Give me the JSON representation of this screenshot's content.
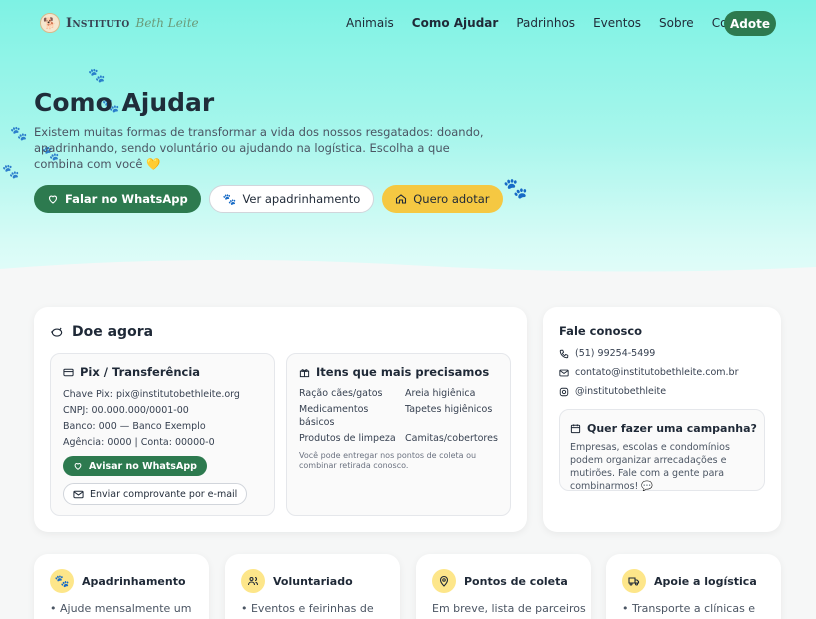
{
  "brand": {
    "name": "Instituto",
    "script": "Beth Leite"
  },
  "nav": {
    "items": [
      {
        "label": "Animais",
        "active": false
      },
      {
        "label": "Como Ajudar",
        "active": true
      },
      {
        "label": "Padrinhos",
        "active": false
      },
      {
        "label": "Eventos",
        "active": false
      },
      {
        "label": "Sobre",
        "active": false
      },
      {
        "label": "Contato",
        "active": false
      }
    ],
    "cta": "Adote"
  },
  "hero": {
    "title": "Como Ajudar",
    "description": "Existem muitas formas de transformar a vida dos nossos resgatados: doando, apadrinhando, sendo voluntário ou ajudando na logística. Escolha a que combina com você 💛",
    "buttons": {
      "whatsapp": "Falar no WhatsApp",
      "sponsor": "Ver apadrinhamento",
      "adopt": "Quero adotar"
    }
  },
  "donate": {
    "title": "Doe agora",
    "pix": {
      "title": "Pix / Transferência",
      "lines": [
        {
          "label": "Chave Pix:",
          "value": "pix@institutobethleite.org"
        },
        {
          "label": "CNPJ:",
          "value": "00.000.000/0001-00"
        },
        {
          "label": "Banco:",
          "value": "000 — Banco Exemplo"
        },
        {
          "label": "Agência:",
          "value": "0000 | Conta: 00000-0"
        }
      ],
      "whatsapp_btn": "Avisar no WhatsApp",
      "email_btn": "Enviar comprovante por e-mail"
    },
    "needs": {
      "title": "Itens que mais precisamos",
      "items": [
        "Ração cães/gatos",
        "Areia higiênica",
        "Medicamentos básicos",
        "Tapetes higiênicos",
        "Produtos de limpeza",
        "Camitas/cobertores"
      ],
      "note": "Você pode entregar nos pontos de coleta ou combinar retirada conosco."
    }
  },
  "contact": {
    "title": "Fale conosco",
    "phone": "(51) 99254-5499",
    "email": "contato@institutobethleite.com.br",
    "instagram": "@institutobethleite",
    "campaign": {
      "title": "Quer fazer uma campanha?",
      "text": "Empresas, escolas e condomínios podem organizar arrecadações e mutirões. Fale com a gente para combinarmos! 💬"
    }
  },
  "features": [
    {
      "title": "Apadrinhamento",
      "text": "• Ajude mensalmente um"
    },
    {
      "title": "Voluntariado",
      "text": "• Eventos e feirinhas de"
    },
    {
      "title": "Pontos de coleta",
      "text": "Em breve, lista de parceiros"
    },
    {
      "title": "Apoie a logística",
      "text": "• Transporte a clínicas e"
    }
  ]
}
